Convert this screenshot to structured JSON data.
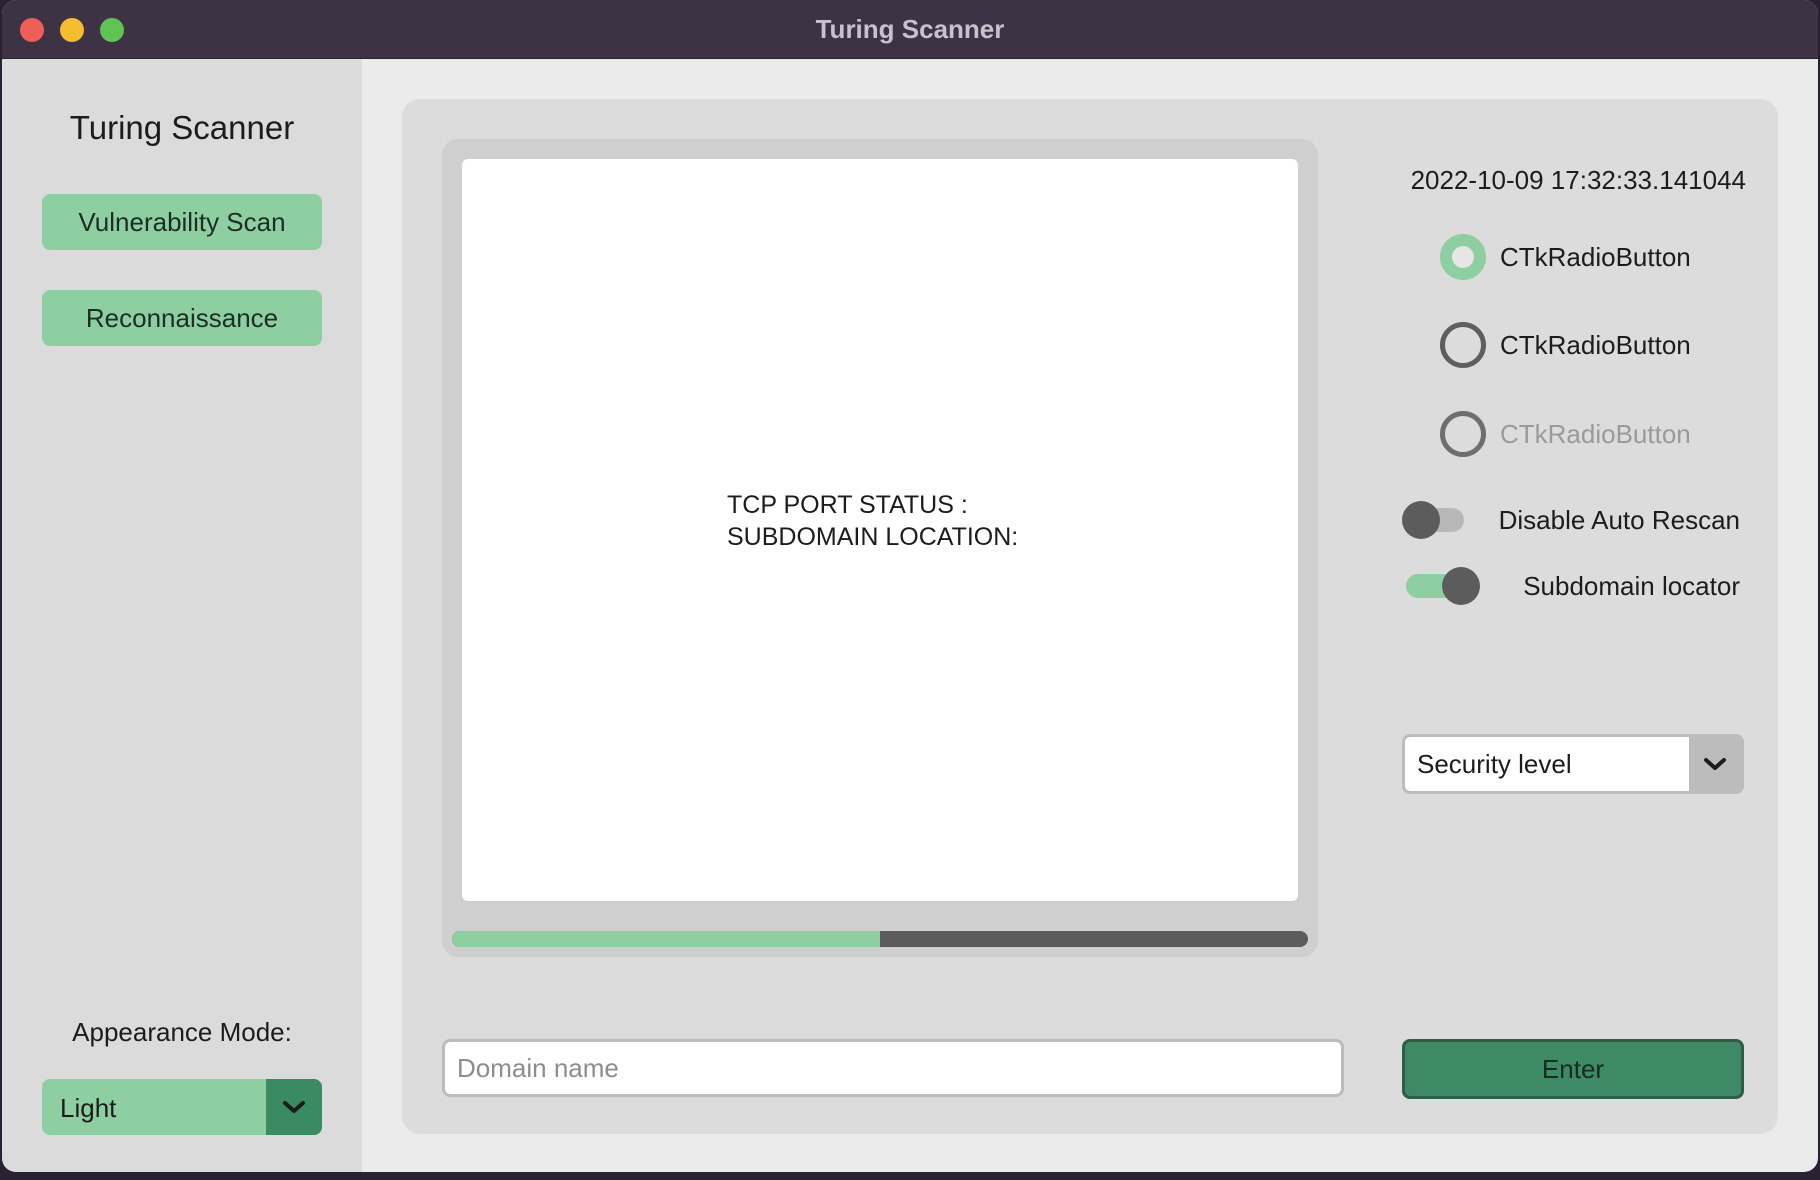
{
  "window": {
    "title": "Turing Scanner"
  },
  "sidebar": {
    "title": "Turing Scanner",
    "buttons": [
      {
        "label": "Vulnerability Scan"
      },
      {
        "label": "Reconnaissance"
      }
    ],
    "appearance_label": "Appearance Mode:",
    "appearance_value": "Light"
  },
  "main": {
    "output_text": "TCP PORT STATUS :\nSUBDOMAIN LOCATION:",
    "progress": 0.5,
    "domain_input": {
      "value": "",
      "placeholder": "Domain name"
    },
    "timestamp": "2022-10-09 17:32:33.141044",
    "radios": [
      {
        "label": "CTkRadioButton",
        "checked": true,
        "disabled": false
      },
      {
        "label": "CTkRadioButton",
        "checked": false,
        "disabled": false
      },
      {
        "label": "CTkRadioButton",
        "checked": false,
        "disabled": true
      }
    ],
    "switches": [
      {
        "label": "Disable Auto Rescan",
        "on": false
      },
      {
        "label": "Subdomain locator",
        "on": true
      }
    ],
    "security_select": {
      "value": "Security level"
    },
    "enter_label": "Enter"
  },
  "colors": {
    "accent": "#8ecfa1",
    "accent_dark": "#3d8a65",
    "titlebar": "#3e3345"
  }
}
